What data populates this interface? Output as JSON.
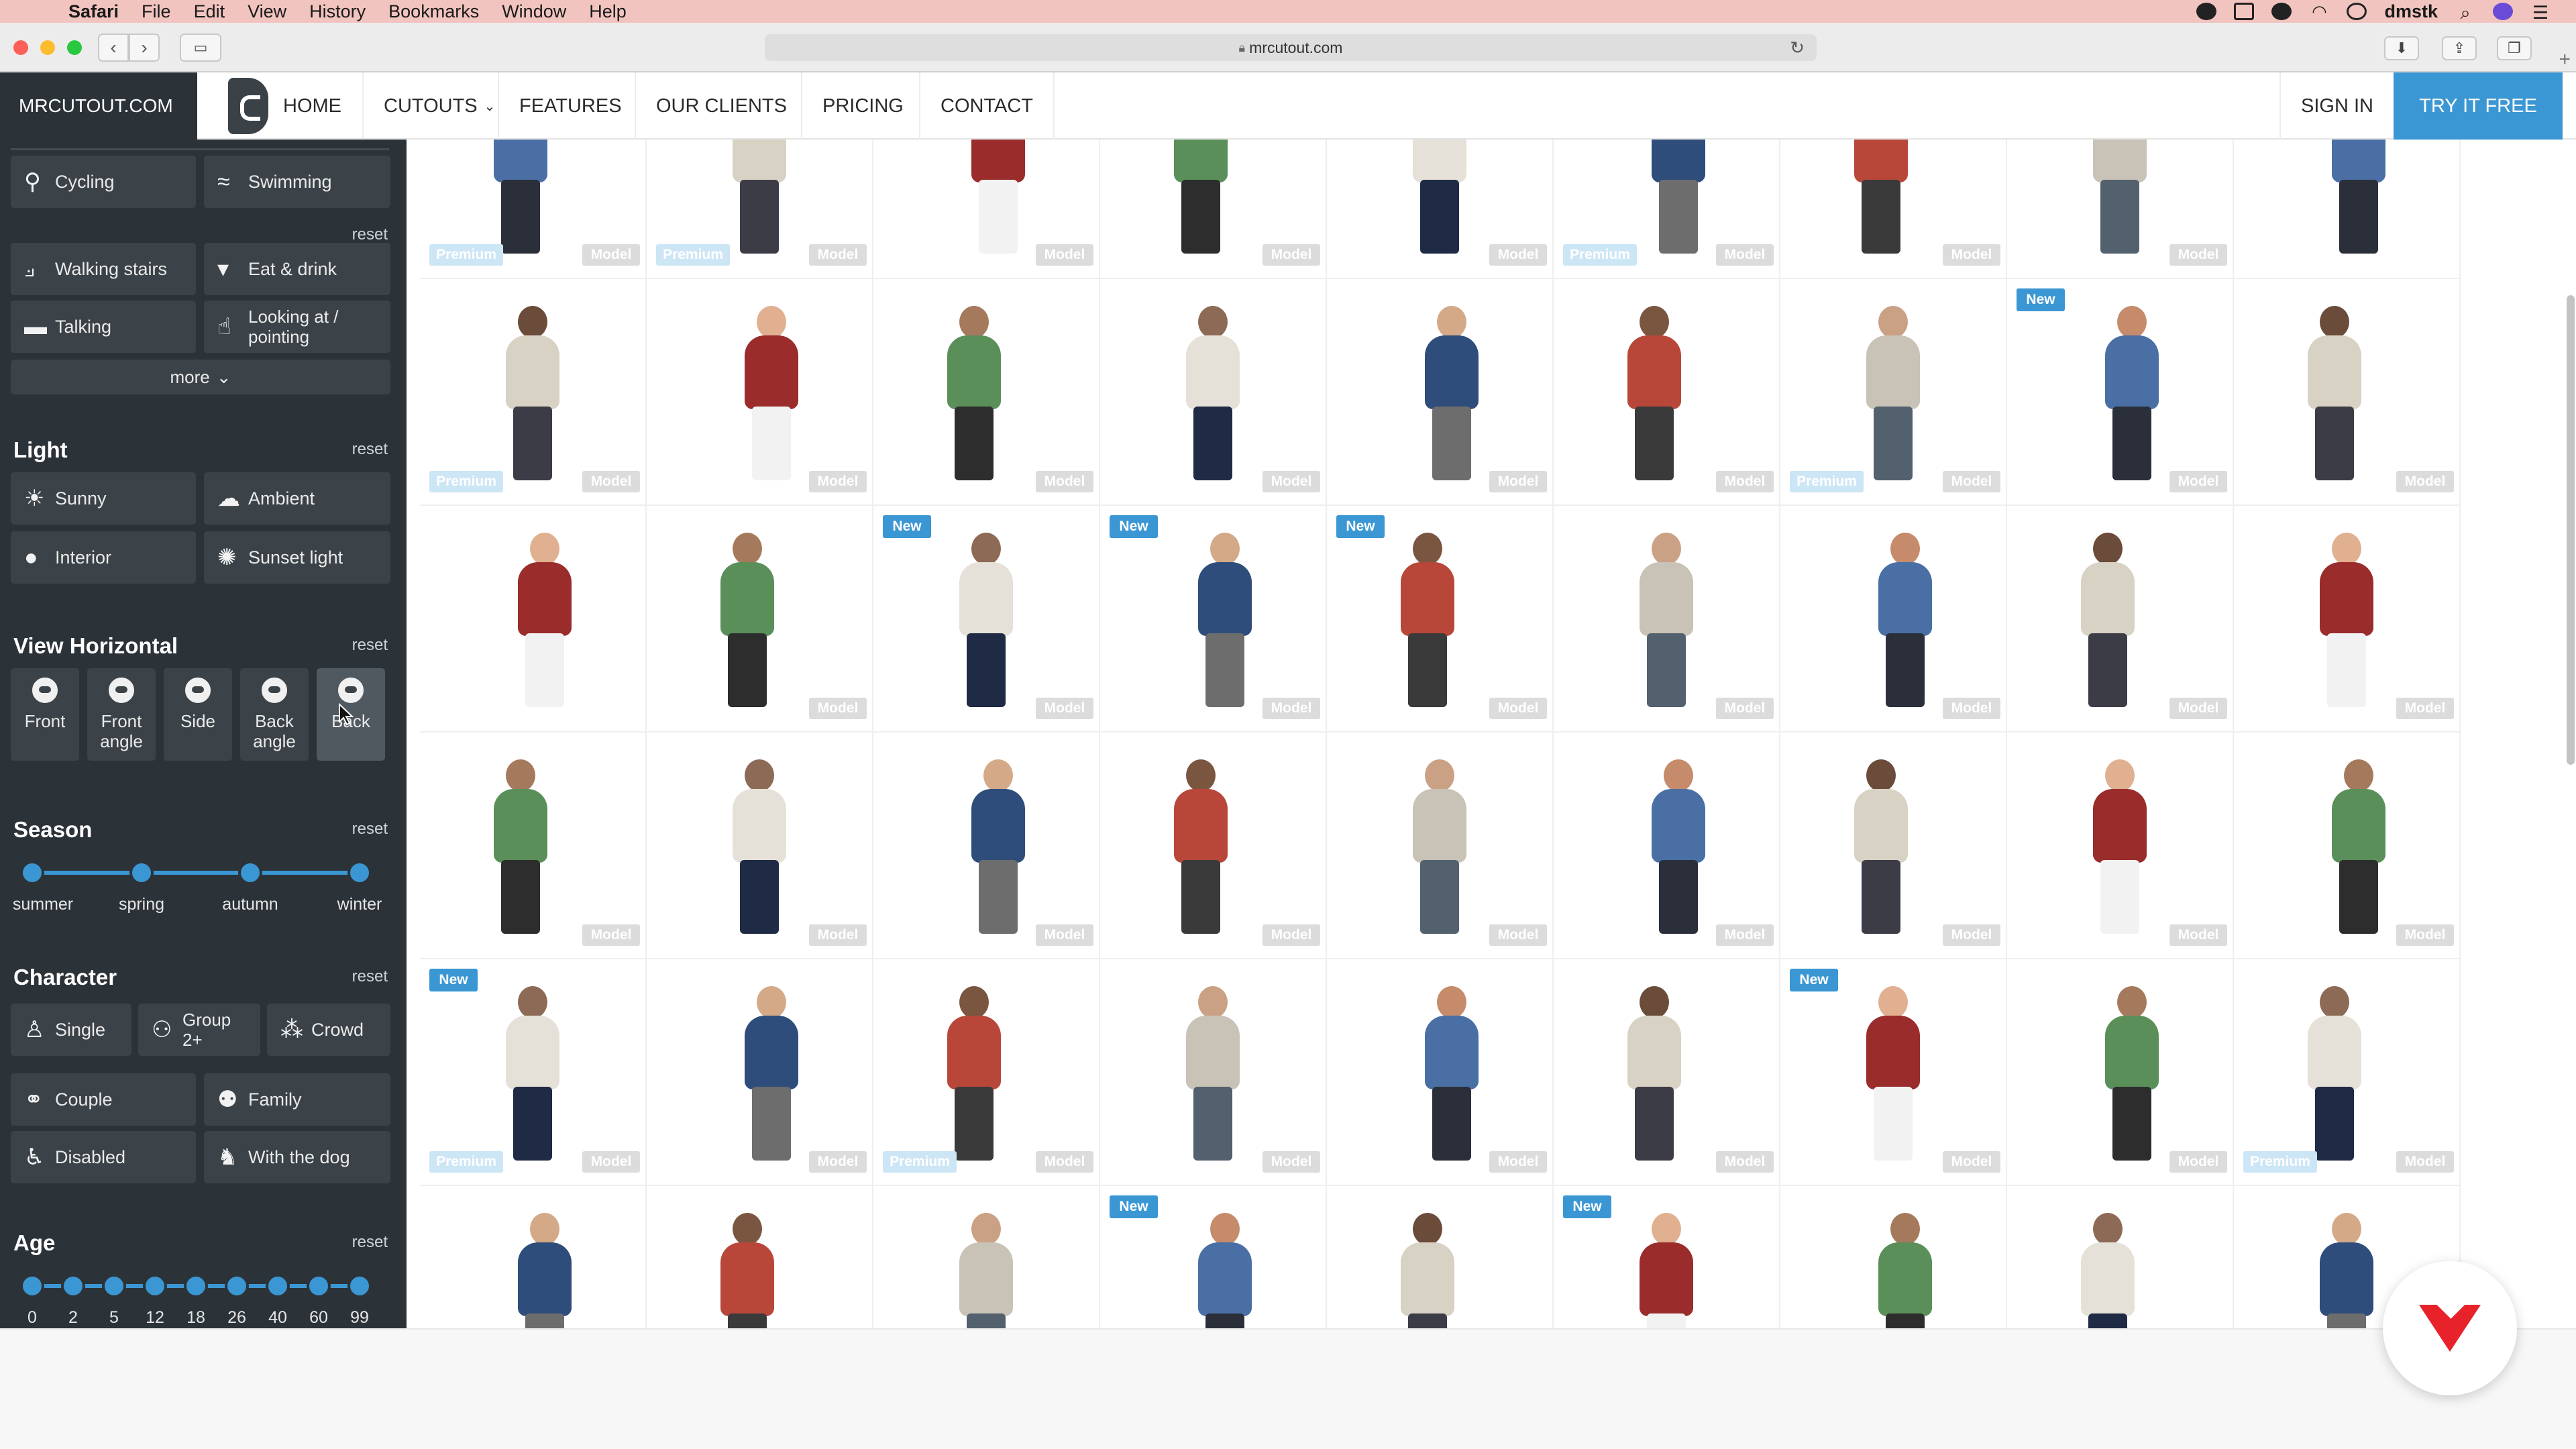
{
  "menubar": {
    "app": "Safari",
    "items": [
      "File",
      "Edit",
      "View",
      "History",
      "Bookmarks",
      "Window",
      "Help"
    ],
    "user": "dmstk"
  },
  "browser": {
    "url": "mrcutout.com"
  },
  "site": {
    "brand": "MRCUTOUT.COM",
    "nav": [
      "HOME",
      "CUTOUTS",
      "FEATURES",
      "OUR CLIENTS",
      "PRICING",
      "CONTACT"
    ],
    "sign_in": "SIGN IN",
    "try_free": "TRY IT FREE"
  },
  "sidebar": {
    "reset_label": "reset",
    "activity": {
      "buttons": [
        {
          "label": "Cycling",
          "icon": "bicycle-icon"
        },
        {
          "label": "Swimming",
          "icon": "swimmer-icon"
        },
        {
          "label": "Walking stairs",
          "icon": "stairs-icon"
        },
        {
          "label": "Eat & drink",
          "icon": "cup-icon"
        },
        {
          "label": "Talking",
          "icon": "speech-icon"
        },
        {
          "label": "Looking at / pointing",
          "icon": "pointing-icon"
        }
      ],
      "more": "more"
    },
    "light": {
      "title": "Light",
      "buttons": [
        {
          "label": "Sunny",
          "icon": "sun-icon"
        },
        {
          "label": "Ambient",
          "icon": "cloud-icon"
        },
        {
          "label": "Interior",
          "icon": "bulb-icon"
        },
        {
          "label": "Sunset light",
          "icon": "sunset-icon"
        }
      ]
    },
    "view_horizontal": {
      "title": "View Horizontal",
      "buttons": [
        "Front",
        "Front angle",
        "Side",
        "Back angle",
        "Back"
      ]
    },
    "season": {
      "title": "Season",
      "stops": [
        "summer",
        "spring",
        "autumn",
        "winter"
      ]
    },
    "character": {
      "title": "Character",
      "buttons": [
        {
          "label": "Single",
          "icon": "person-icon"
        },
        {
          "label": "Group 2+",
          "icon": "group-icon"
        },
        {
          "label": "Crowd",
          "icon": "crowd-icon"
        },
        {
          "label": "Couple",
          "icon": "couple-icon"
        },
        {
          "label": "Family",
          "icon": "family-icon"
        },
        {
          "label": "Disabled",
          "icon": "wheelchair-icon"
        },
        {
          "label": "With the dog",
          "icon": "dog-icon"
        }
      ]
    },
    "age": {
      "title": "Age",
      "stops": [
        "0",
        "2",
        "5",
        "12",
        "18",
        "26",
        "40",
        "60",
        "99"
      ]
    }
  },
  "tags": {
    "model": "Model",
    "premium": "Premium",
    "new": "New"
  },
  "grid": {
    "rows": [
      [
        "PM",
        "PM",
        "M",
        "M",
        "M",
        "PM",
        "M",
        "M",
        ""
      ],
      [
        "PM",
        "M",
        "M",
        "M",
        "M",
        "M",
        "PM",
        "NM",
        "M"
      ],
      [
        "",
        "M",
        "NM",
        "NM",
        "NM",
        "M",
        "M",
        "M",
        "M"
      ],
      [
        "M",
        "M",
        "M",
        "M",
        "M",
        "M",
        "M",
        "M",
        "M"
      ],
      [
        "NPM",
        "M",
        "PM",
        "M",
        "M",
        "M",
        "NM",
        "M",
        "PM"
      ],
      [
        "",
        "",
        "",
        "N",
        "",
        "N",
        "",
        "",
        ""
      ]
    ]
  },
  "colors": {
    "accent": "#3b97d3",
    "sidebar": "#2c3338",
    "menubar": "#f2c4bf"
  }
}
